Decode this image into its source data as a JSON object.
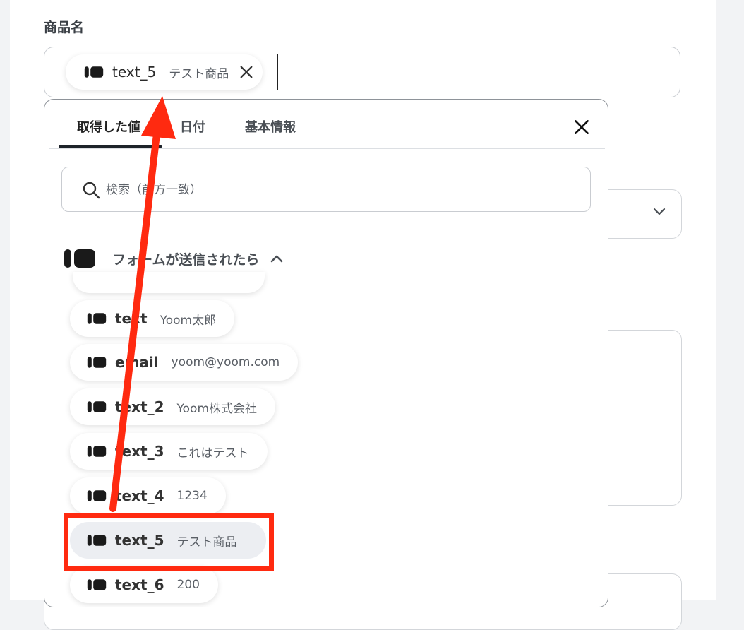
{
  "field": {
    "label": "商品名"
  },
  "selected_token": {
    "key": "text_5",
    "value": "テスト商品",
    "remove_icon": "close-icon"
  },
  "popup": {
    "tabs": [
      {
        "label": "取得した値",
        "active": true
      },
      {
        "label": "日付",
        "active": false
      },
      {
        "label": "基本情報",
        "active": false
      }
    ],
    "close_icon": "close-icon",
    "search": {
      "placeholder": "検索（前方一致）",
      "icon": "search-icon"
    },
    "group": {
      "title": "フォームが送信されたら",
      "icon": "yoom-logo-icon",
      "state_icon": "chevron-up-icon"
    },
    "items": [
      {
        "key": "text",
        "value": "Yoom太郎",
        "selected": false
      },
      {
        "key": "email",
        "value": "yoom@yoom.com",
        "selected": false
      },
      {
        "key": "text_2",
        "value": "Yoom株式会社",
        "selected": false
      },
      {
        "key": "text_3",
        "value": "これはテスト",
        "selected": false
      },
      {
        "key": "text_4",
        "value": "1234",
        "selected": false
      },
      {
        "key": "text_5",
        "value": "テスト商品",
        "selected": true
      },
      {
        "key": "text_6",
        "value": "200",
        "selected": false
      }
    ]
  },
  "annotation": {
    "highlight_color": "#ff2a10",
    "arrow_color": "#ff2a10"
  },
  "colors": {
    "page_bg": "#f2f3f5",
    "panel_bg": "#ffffff",
    "chip_selected_bg": "#eceef2",
    "tab_underline": "#1d232a"
  }
}
